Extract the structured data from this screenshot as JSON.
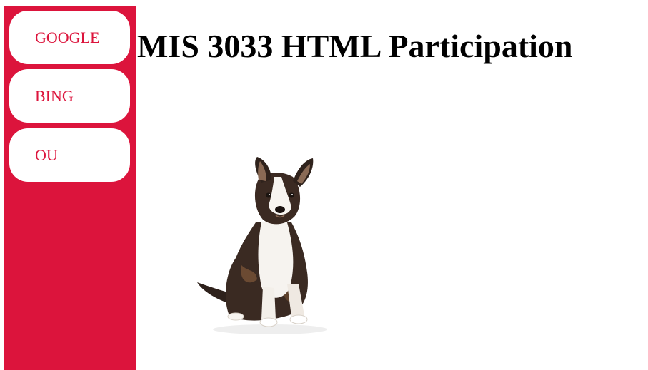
{
  "sidebar": {
    "bg_color": "#dc143c",
    "links": [
      {
        "label": "GOOGLE"
      },
      {
        "label": "BING"
      },
      {
        "label": "OU"
      }
    ]
  },
  "main": {
    "title": "MIS 3033 HTML Participation",
    "image_icon": "puppy-image"
  }
}
